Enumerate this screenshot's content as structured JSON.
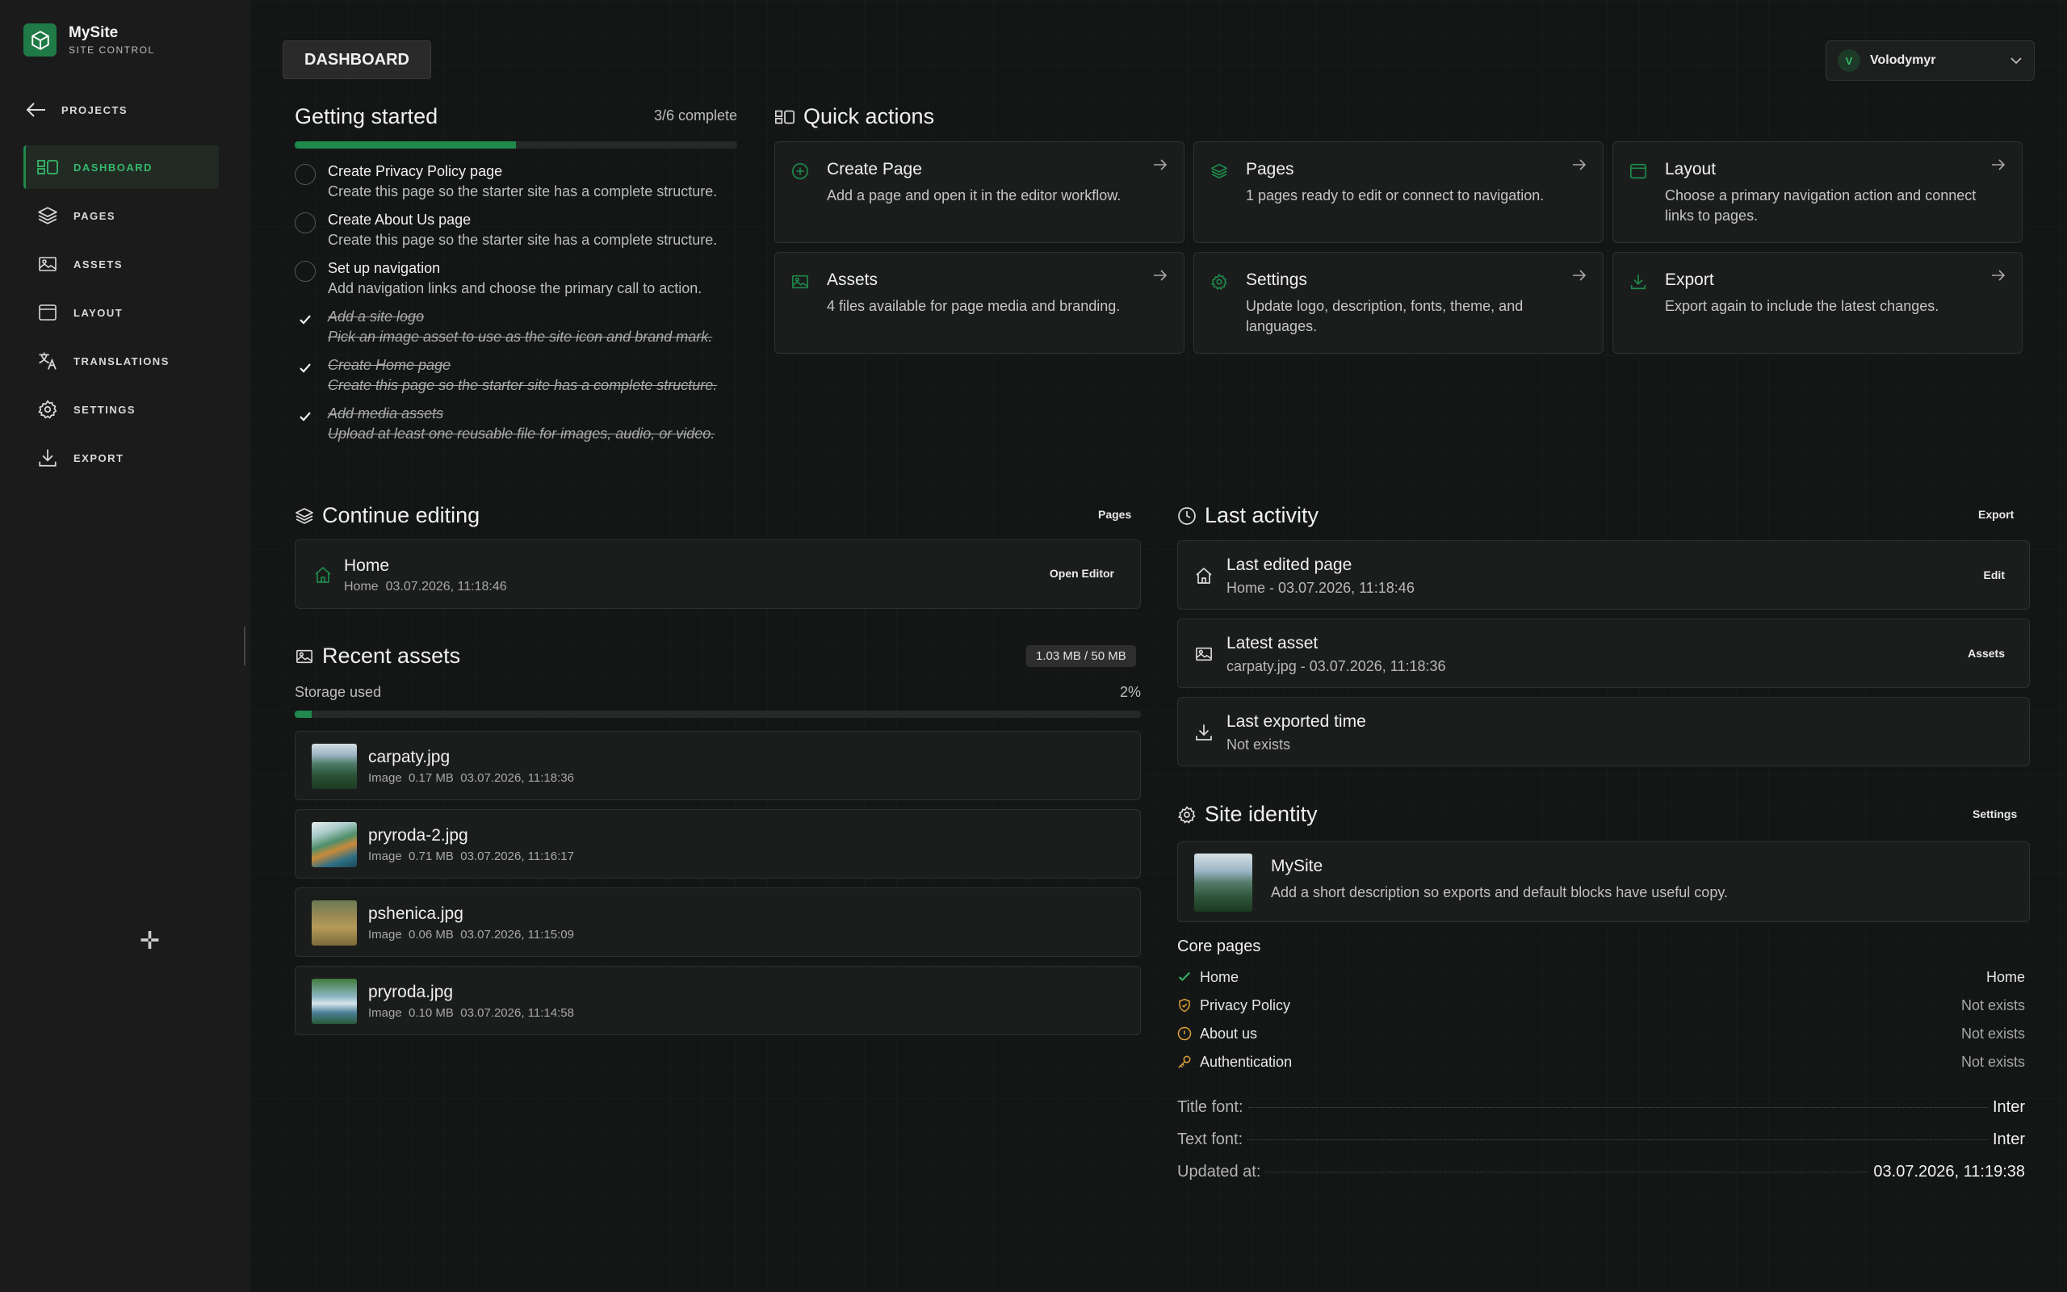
{
  "brand": {
    "name": "MySite",
    "subtitle": "SITE CONTROL"
  },
  "sidebar": {
    "back_label": "PROJECTS",
    "items": [
      {
        "label": "DASHBOARD",
        "icon": "dashboard-icon",
        "active": true
      },
      {
        "label": "PAGES",
        "icon": "layers-icon"
      },
      {
        "label": "ASSETS",
        "icon": "image-icon"
      },
      {
        "label": "LAYOUT",
        "icon": "layout-icon"
      },
      {
        "label": "TRANSLATIONS",
        "icon": "translate-icon"
      },
      {
        "label": "SETTINGS",
        "icon": "gear-icon"
      },
      {
        "label": "EXPORT",
        "icon": "download-icon"
      }
    ]
  },
  "header": {
    "page_tab": "DASHBOARD",
    "user": {
      "initial": "V",
      "name": "Volodymyr"
    }
  },
  "getting_started": {
    "title": "Getting started",
    "progress_text": "3/6 complete",
    "progress": 0.5,
    "items": [
      {
        "title": "Create Privacy Policy page",
        "desc": "Create this page so the starter site has a complete structure.",
        "done": false
      },
      {
        "title": "Create About Us page",
        "desc": "Create this page so the starter site has a complete structure.",
        "done": false
      },
      {
        "title": "Set up navigation",
        "desc": "Add navigation links and choose the primary call to action.",
        "done": false
      },
      {
        "title": "Add a site logo",
        "desc": "Pick an image asset to use as the site icon and brand mark.",
        "done": true
      },
      {
        "title": "Create Home page",
        "desc": "Create this page so the starter site has a complete structure.",
        "done": true
      },
      {
        "title": "Add media assets",
        "desc": "Upload at least one reusable file for images, audio, or video.",
        "done": true
      }
    ]
  },
  "quick_actions": {
    "title": "Quick actions",
    "cards": [
      {
        "title": "Create Page",
        "desc": "Add a page and open it in the editor workflow.",
        "icon": "plus-circle-icon"
      },
      {
        "title": "Pages",
        "desc": "1 pages ready to edit or connect to navigation.",
        "icon": "layers-icon"
      },
      {
        "title": "Layout",
        "desc": "Choose a primary navigation action and connect links to pages.",
        "icon": "layout-icon"
      },
      {
        "title": "Assets",
        "desc": "4 files available for page media and branding.",
        "icon": "image-icon"
      },
      {
        "title": "Settings",
        "desc": "Update logo, description, fonts, theme, and languages.",
        "icon": "gear-icon"
      },
      {
        "title": "Export",
        "desc": "Export again to include the latest changes.",
        "icon": "download-icon"
      }
    ]
  },
  "continue_editing": {
    "title": "Continue editing",
    "link": "Pages",
    "item": {
      "title": "Home",
      "meta": "Home",
      "time": "03.07.2026, 11:18:46",
      "action": "Open Editor"
    }
  },
  "recent_assets": {
    "title": "Recent assets",
    "badge": "1.03 MB / 50 MB",
    "storage_label": "Storage used",
    "storage_percent": "2%",
    "storage_fraction": 0.02,
    "items": [
      {
        "name": "carpaty.jpg",
        "type": "Image",
        "size": "0.17 MB",
        "time": "03.07.2026, 11:18:36"
      },
      {
        "name": "pryroda-2.jpg",
        "type": "Image",
        "size": "0.71 MB",
        "time": "03.07.2026, 11:16:17"
      },
      {
        "name": "pshenica.jpg",
        "type": "Image",
        "size": "0.06 MB",
        "time": "03.07.2026, 11:15:09"
      },
      {
        "name": "pryroda.jpg",
        "type": "Image",
        "size": "0.10 MB",
        "time": "03.07.2026, 11:14:58"
      }
    ]
  },
  "last_activity": {
    "title": "Last activity",
    "link": "Export",
    "items": [
      {
        "title": "Last edited page",
        "sub": "Home - 03.07.2026, 11:18:46",
        "action": "Edit",
        "icon": "home-icon"
      },
      {
        "title": "Latest asset",
        "sub": "carpaty.jpg - 03.07.2026, 11:18:36",
        "action": "Assets",
        "icon": "image-icon"
      },
      {
        "title": "Last exported time",
        "sub": "Not exists",
        "action": "",
        "icon": "download-icon"
      }
    ]
  },
  "site_identity": {
    "title": "Site identity",
    "link": "Settings",
    "name": "MySite",
    "desc": "Add a short description so exports and default blocks have useful copy.",
    "core_pages_title": "Core pages",
    "core_pages": [
      {
        "label": "Home",
        "value": "Home",
        "status": "ok"
      },
      {
        "label": "Privacy Policy",
        "value": "Not exists",
        "status": "shield"
      },
      {
        "label": "About us",
        "value": "Not exists",
        "status": "info"
      },
      {
        "label": "Authentication",
        "value": "Not exists",
        "status": "key"
      }
    ],
    "fonts": [
      {
        "label": "Title font:",
        "value": "Inter"
      },
      {
        "label": "Text font:",
        "value": "Inter"
      },
      {
        "label": "Updated at:",
        "value": "03.07.2026, 11:19:38"
      }
    ]
  },
  "colors": {
    "accent": "#1f8a4c",
    "warning": "#e0a23a"
  }
}
